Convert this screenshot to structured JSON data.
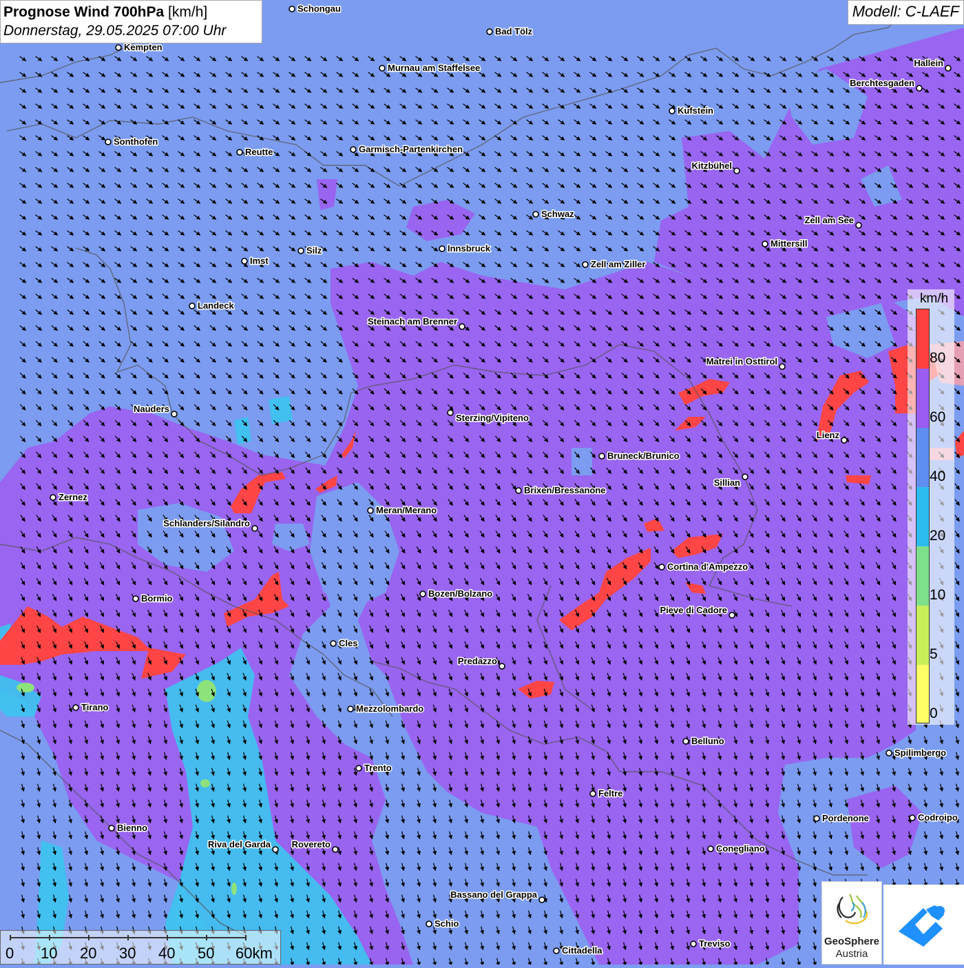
{
  "title": {
    "main": "Prognose Wind 700hPa",
    "unit": "[km/h]",
    "datetime": "Donnerstag, 29.05.2025 07:00 Uhr"
  },
  "model": "Modell: C-LAEF",
  "legend": {
    "unit": "km/h",
    "labels": [
      "80",
      "60",
      "40",
      "20",
      "10",
      "5",
      "0"
    ],
    "colors": [
      "#ff4040",
      "#9a5cf2",
      "#5f8ef0",
      "#2ebcee",
      "#7ee08a",
      "#c8ef5a",
      "#ffff66"
    ]
  },
  "wind_arrows": {
    "direction": "south-east / south",
    "color": "#000000"
  },
  "scalebar": {
    "ticks": [
      "0",
      "10",
      "20",
      "30",
      "40",
      "50",
      "60km"
    ]
  },
  "logos": {
    "geosphere_name": "GeoSphere",
    "geosphere_country": "Austria"
  },
  "cities": [
    {
      "name": "Schongau"
    },
    {
      "name": "Bad Tölz"
    },
    {
      "name": "Kempten"
    },
    {
      "name": "Murnau am Staffelsee"
    },
    {
      "name": "Hallein"
    },
    {
      "name": "Berchtesgaden"
    },
    {
      "name": "Kufstein"
    },
    {
      "name": "Sonthofen"
    },
    {
      "name": "Reutte"
    },
    {
      "name": "Garmisch-Partenkirchen"
    },
    {
      "name": "Kitzbühel"
    },
    {
      "name": "Schwaz"
    },
    {
      "name": "Zell am See"
    },
    {
      "name": "Mittersill"
    },
    {
      "name": "Innsbruck"
    },
    {
      "name": "Silz"
    },
    {
      "name": "Imst"
    },
    {
      "name": "Zell am Ziller"
    },
    {
      "name": "Landeck"
    },
    {
      "name": "Steinach am Brenner"
    },
    {
      "name": "Matrei in Osttirol"
    },
    {
      "name": "Nauders"
    },
    {
      "name": "Sterzing/Vipiteno"
    },
    {
      "name": "Lienz"
    },
    {
      "name": "Bruneck/Brunico"
    },
    {
      "name": "Sillian"
    },
    {
      "name": "Brixen/Bressanone"
    },
    {
      "name": "Zernez"
    },
    {
      "name": "Meran/Merano"
    },
    {
      "name": "Schlanders/Silandro"
    },
    {
      "name": "Cortina d'Ampezzo"
    },
    {
      "name": "Bozen/Bolzano"
    },
    {
      "name": "Bormio"
    },
    {
      "name": "Pieve di Cadore"
    },
    {
      "name": "Cles"
    },
    {
      "name": "Predazzo"
    },
    {
      "name": "Tirano"
    },
    {
      "name": "Mezzolombardo"
    },
    {
      "name": "Belluno"
    },
    {
      "name": "Spilimbergo"
    },
    {
      "name": "Trento"
    },
    {
      "name": "Feltre"
    },
    {
      "name": "Bienno"
    },
    {
      "name": "Pordenone"
    },
    {
      "name": "Codroipo"
    },
    {
      "name": "Riva del Garda"
    },
    {
      "name": "Rovereto"
    },
    {
      "name": "Conegliano"
    },
    {
      "name": "Bassano del Grappa"
    },
    {
      "name": "Schio"
    },
    {
      "name": "Treviso"
    },
    {
      "name": "Cittadella"
    }
  ]
}
